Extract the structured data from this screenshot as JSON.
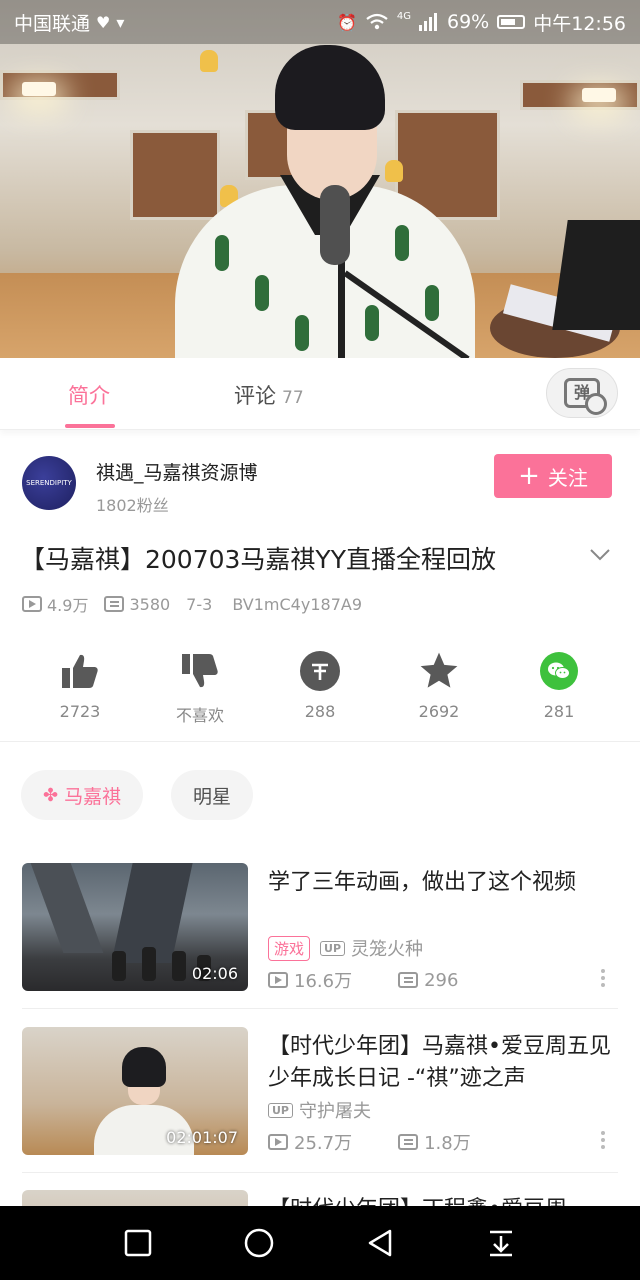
{
  "status_bar": {
    "carrier": "中国联通",
    "network": "4G",
    "battery": "69%",
    "time": "中午12:56"
  },
  "tabs": {
    "intro": "简介",
    "comments": "评论",
    "comments_count": "77",
    "danmaku_glyph": "弹"
  },
  "uploader": {
    "name": "祺遇_马嘉祺资源博",
    "fans": "1802粉丝",
    "follow": "关注",
    "avatar_text": "SERENDIPITY 1212"
  },
  "video": {
    "title": "【马嘉祺】200703马嘉祺YY直播全程回放",
    "views": "4.9万",
    "danmaku": "3580",
    "date": "7-3",
    "bvid": "BV1mC4y187A9"
  },
  "actions": {
    "like": "2723",
    "dislike": "不喜欢",
    "coin": "288",
    "favorite": "2692",
    "share": "281"
  },
  "tags": [
    "马嘉祺",
    "明星"
  ],
  "related": [
    {
      "title": "学了三年动画，做出了这个视频",
      "badge": "游戏",
      "up_label": "UP",
      "author": "灵笼火种",
      "views": "16.6万",
      "danmaku": "296",
      "duration": "02:06"
    },
    {
      "title": "【时代少年团】马嘉祺•爱豆周五见 少年成长日记 -“祺”迹之声",
      "up_label": "UP",
      "author": "守护屠夫",
      "views": "25.7万",
      "danmaku": "1.8万",
      "duration": "02:01:07"
    },
    {
      "title": "【时代少年团】丁程鑫•爱豆周"
    }
  ],
  "colors": {
    "accent": "#fb7299",
    "wechat": "#3ec13d"
  }
}
